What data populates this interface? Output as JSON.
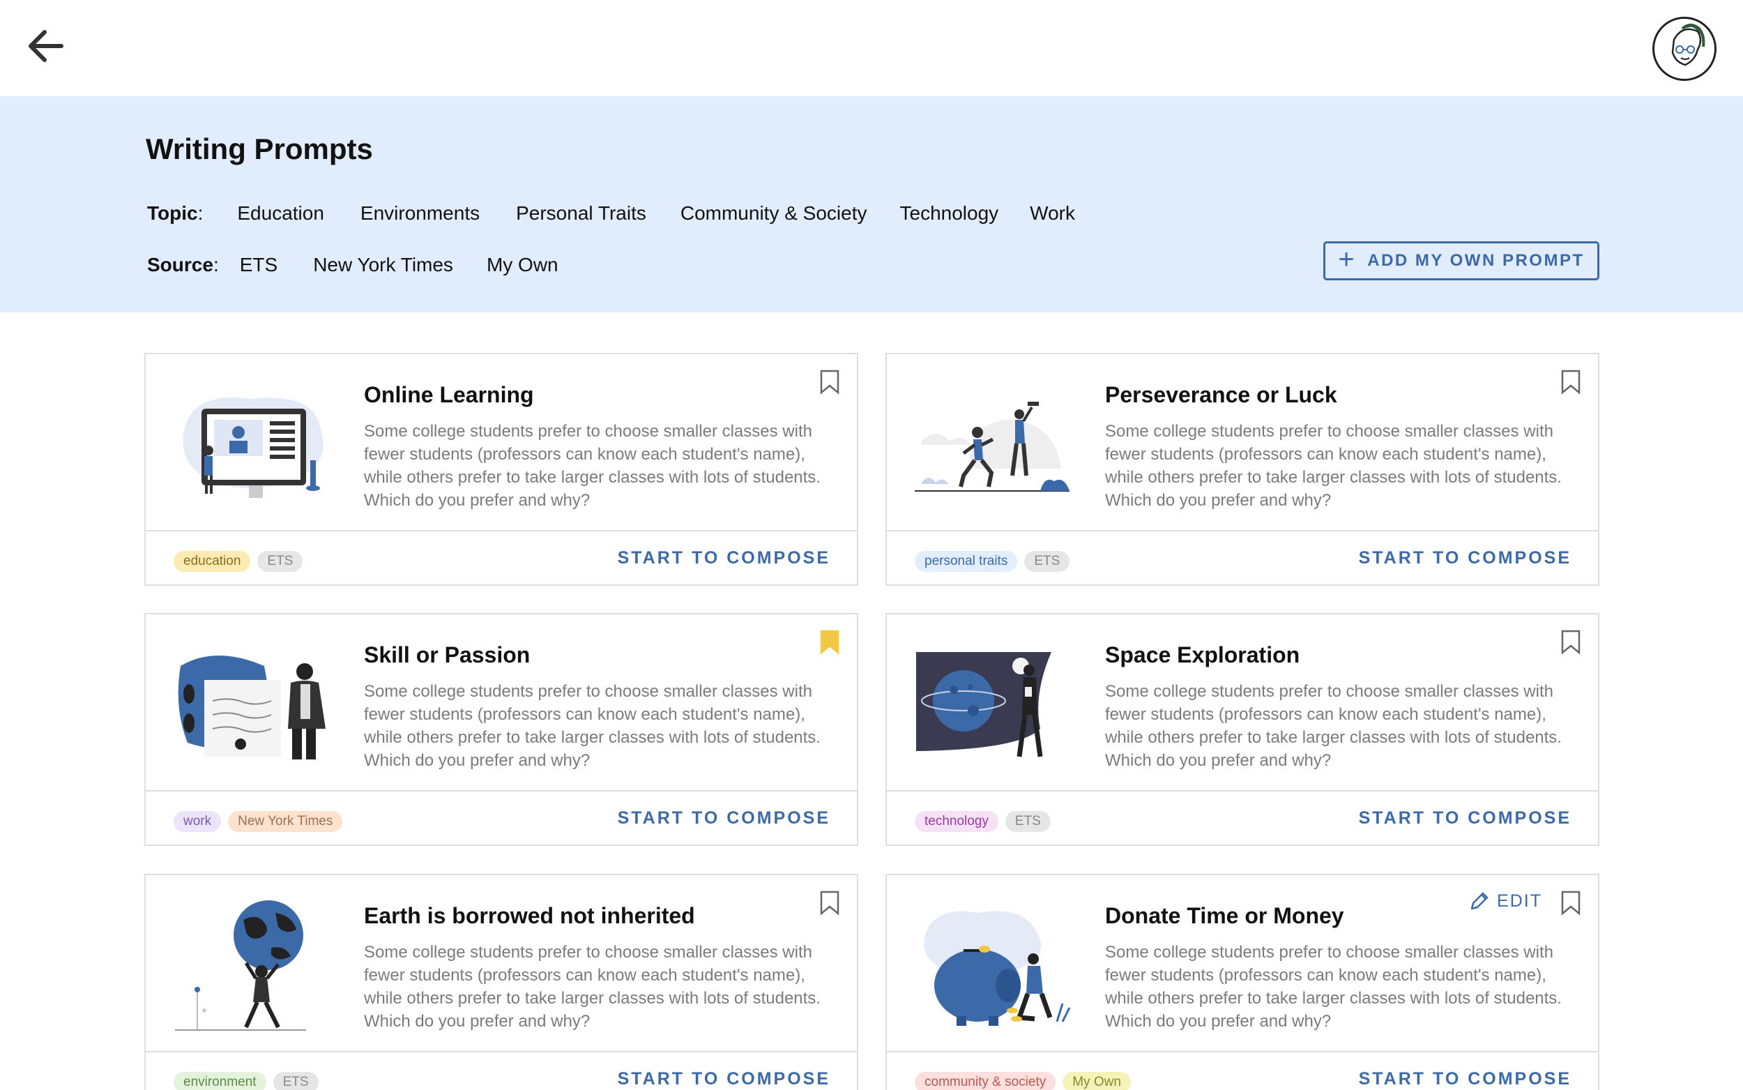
{
  "header": {
    "title": "Writing Prompts",
    "topic_label": "Topic",
    "source_label": "Source",
    "topics": [
      "Education",
      "Environments",
      "Personal Traits",
      "Community & Society",
      "Technology",
      "Work"
    ],
    "sources": [
      "ETS",
      "New York Times",
      "My Own"
    ],
    "add_prompt_label": "ADD MY OWN PROMPT"
  },
  "colors": {
    "accent": "#3c6aa8",
    "banner_bg": "#e1ecfd",
    "bookmark_active": "#f2c744"
  },
  "cards": [
    {
      "title": "Online Learning",
      "description": "Some college students prefer to choose smaller classes with fewer students (professors can know each student's name), while others prefer to take larger classes with lots of students. Which do you prefer and why?",
      "tags": [
        {
          "label": "education",
          "bg": "#fcecb4",
          "fg": "#8a6d1c"
        },
        {
          "label": "ETS",
          "bg": "#e6e6e6",
          "fg": "#888888"
        }
      ],
      "bookmarked": false,
      "compose_label": "START TO COMPOSE",
      "illustration": "online-learning-illustration"
    },
    {
      "title": "Perseverance or Luck",
      "description": "Some college students prefer to choose smaller classes with fewer students (professors can know each student's name), while others prefer to take larger classes with lots of students. Which do you prefer and why?",
      "tags": [
        {
          "label": "personal traits",
          "bg": "#e2eefb",
          "fg": "#3c6aa8"
        },
        {
          "label": "ETS",
          "bg": "#e6e6e6",
          "fg": "#888888"
        }
      ],
      "bookmarked": false,
      "compose_label": "START TO COMPOSE",
      "illustration": "runners-illustration"
    },
    {
      "title": "Skill or Passion",
      "description": "Some college students prefer to choose smaller classes with fewer students (professors can know each student's name), while others prefer to take larger classes with lots of students. Which do you prefer and why?",
      "tags": [
        {
          "label": "work",
          "bg": "#ece4fb",
          "fg": "#7a5bb8"
        },
        {
          "label": "New York Times",
          "bg": "#fde2cf",
          "fg": "#a07050"
        }
      ],
      "bookmarked": true,
      "compose_label": "START TO COMPOSE",
      "illustration": "presenter-illustration"
    },
    {
      "title": "Space Exploration",
      "description": "Some college students prefer to choose smaller classes with fewer students (professors can know each student's name), while others prefer to take larger classes with lots of students. Which do you prefer and why?",
      "tags": [
        {
          "label": "technology",
          "bg": "#f6e2f7",
          "fg": "#9a3aa0"
        },
        {
          "label": "ETS",
          "bg": "#e6e6e6",
          "fg": "#888888"
        }
      ],
      "bookmarked": false,
      "compose_label": "START TO COMPOSE",
      "illustration": "space-illustration"
    },
    {
      "title": "Earth is borrowed not inherited",
      "description": "Some college students prefer to choose smaller classes with fewer students (professors can know each student's name), while others prefer to take larger classes with lots of students. Which do you prefer and why?",
      "tags": [
        {
          "label": "environment",
          "bg": "#e4f3dc",
          "fg": "#5b8a48"
        },
        {
          "label": "ETS",
          "bg": "#e6e6e6",
          "fg": "#888888"
        }
      ],
      "bookmarked": false,
      "compose_label": "START TO COMPOSE",
      "illustration": "globe-carrier-illustration"
    },
    {
      "title": "Donate Time or Money",
      "description": "Some college students prefer to choose smaller classes with fewer students (professors can know each student's name), while others prefer to take larger classes with lots of students. Which do you prefer and why?",
      "tags": [
        {
          "label": "community & society",
          "bg": "#fde0dd",
          "fg": "#b45a50"
        },
        {
          "label": "My Own",
          "bg": "#f6f3b8",
          "fg": "#8a8630"
        }
      ],
      "bookmarked": false,
      "edit_label": "EDIT",
      "compose_label": "START TO COMPOSE",
      "illustration": "piggy-bank-illustration"
    }
  ]
}
